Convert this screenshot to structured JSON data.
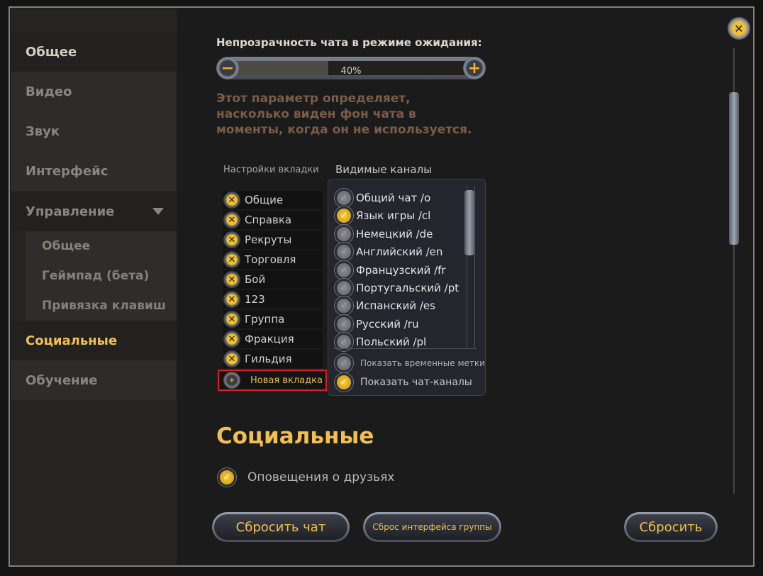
{
  "sidebar": {
    "items": [
      "Общее",
      "Видео",
      "Звук",
      "Интерфейс",
      "Управление",
      "Социальные",
      "Обучение"
    ],
    "sub_items": [
      "Общее",
      "Геймпад (бета)",
      "Привязка клавиш"
    ],
    "active": "Социальные"
  },
  "opacity": {
    "label": "Непрозрачность чата в режиме ожидания:",
    "value": "40%",
    "value_percent": 40,
    "description": "Этот параметр определяет, насколько виден фон чата в моменты, когда он не используется."
  },
  "tabs": {
    "header": "Настройки вкладки",
    "items": [
      "Общие",
      "Справка",
      "Рекруты",
      "Торговля",
      "Бой",
      "123",
      "Группа",
      "Фракция",
      "Гильдия"
    ],
    "new_tab": "Новая вкладка"
  },
  "channels": {
    "header": "Видимые каналы",
    "items": [
      {
        "label": "Общий чат /o",
        "checked": false
      },
      {
        "label": "Язык игры /cl",
        "checked": true
      },
      {
        "label": "Немецкий /de",
        "checked": false
      },
      {
        "label": "Английский /en",
        "checked": false
      },
      {
        "label": "Французский /fr",
        "checked": false
      },
      {
        "label": "Португальский /pt",
        "checked": false
      },
      {
        "label": "Испанский /es",
        "checked": false
      },
      {
        "label": "Русский /ru",
        "checked": false
      },
      {
        "label": "Польский /pl",
        "checked": false
      }
    ],
    "show_timestamps": {
      "label": "Показать временные метки",
      "checked": false
    },
    "show_channels": {
      "label": "Показать чат-каналы",
      "checked": true
    }
  },
  "social": {
    "title": "Социальные",
    "friend_notifications": {
      "label": "Оповещения о друзьях",
      "checked": true
    }
  },
  "buttons": {
    "reset_chat": "Сбросить чат",
    "reset_group_ui": "Сброс интерфейса группы",
    "reset": "Сбросить"
  },
  "colors": {
    "accent": "#f0c050",
    "description": "#7a5c4a",
    "highlight": "#e01c24"
  }
}
